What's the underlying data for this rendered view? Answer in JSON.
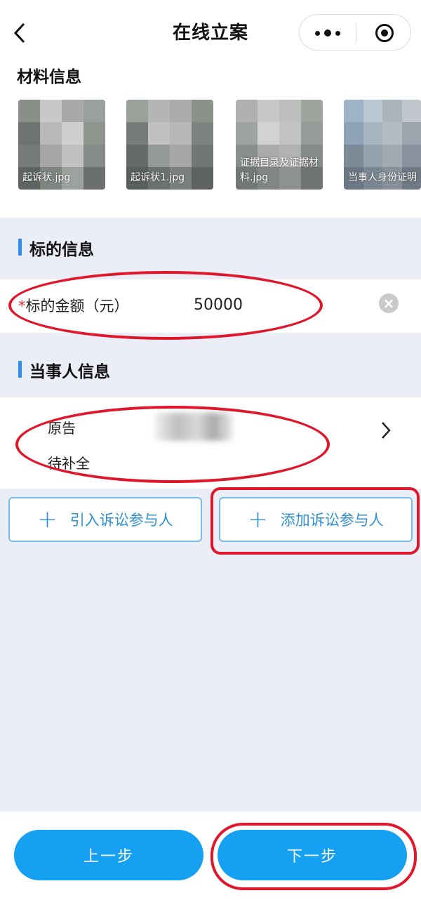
{
  "header": {
    "back_glyph": "‹",
    "title": "在线立案",
    "more_icon": "more-dots-icon",
    "close_icon": "target-circle-icon"
  },
  "materials": {
    "title": "材料信息",
    "files": [
      {
        "name": "起诉状.jpg"
      },
      {
        "name": "起诉状1.jpg"
      },
      {
        "name": "证据目录及证据材料.jpg"
      },
      {
        "name": "当事人身份证明.jpg"
      }
    ]
  },
  "subject": {
    "title": "标的信息",
    "amount_label_required": "*",
    "amount_label": "标的金额（元）",
    "amount_value": "50000",
    "clear_icon": "clear-icon"
  },
  "parties": {
    "title": "当事人信息",
    "role": "原告",
    "status": "待补全",
    "chevron": "›"
  },
  "actions": {
    "import_label": "引入诉讼参与人",
    "add_label": "添加诉讼参与人",
    "plus_glyph": "+"
  },
  "footer": {
    "prev_label": "上一步",
    "next_label": "下一步"
  },
  "colors": {
    "accent": "#15a0f2",
    "section_bar": "#2f8ff0",
    "annotation": "#e0162b",
    "page_bg": "#ebeef7"
  }
}
